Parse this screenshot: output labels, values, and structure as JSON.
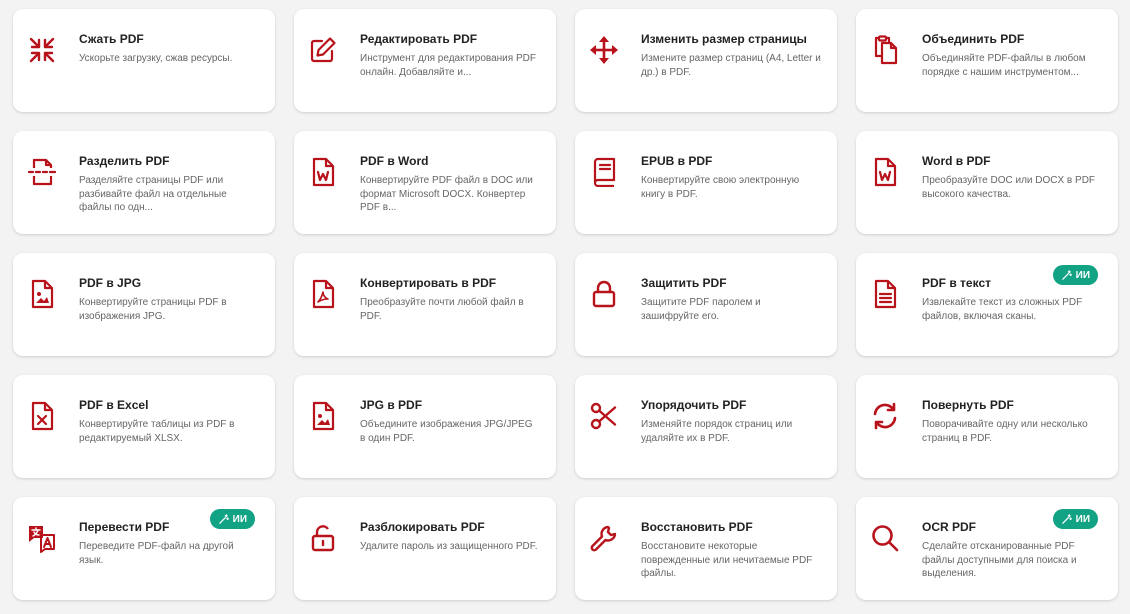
{
  "accent_color": "#b8121b",
  "badge_color": "#12a284",
  "tools": [
    {
      "icon": "compress-icon",
      "title": "Сжать PDF",
      "desc": "Ускорьте загрузку, сжав ресурсы."
    },
    {
      "icon": "edit-icon",
      "title": "Редактировать PDF",
      "desc": "Инструмент для редактирования PDF онлайн. Добавляйте и..."
    },
    {
      "icon": "move-arrows-icon",
      "title": "Изменить размер страницы",
      "desc": "Измените размер страниц (A4, Letter и др.) в PDF."
    },
    {
      "icon": "merge-files-icon",
      "title": "Объединить PDF",
      "desc": "Объединяйте PDF-файлы в любом порядке с нашим инструментом..."
    },
    {
      "icon": "split-icon",
      "title": "Разделить PDF",
      "desc": "Разделяйте страницы PDF или разбивайте файл на отдельные файлы по одн..."
    },
    {
      "icon": "word-file-icon",
      "title": "PDF в Word",
      "desc": "Конвертируйте PDF файл в DOC или формат Microsoft DOCX. Конвертер PDF в..."
    },
    {
      "icon": "book-icon",
      "title": "EPUB в PDF",
      "desc": "Конвертируйте свою электронную книгу в PDF."
    },
    {
      "icon": "word-file-icon",
      "title": "Word в PDF",
      "desc": "Преобразуйте DOC или DOCX в PDF высокого качества."
    },
    {
      "icon": "image-file-icon",
      "title": "PDF в JPG",
      "desc": "Конвертируйте страницы PDF в изображения JPG."
    },
    {
      "icon": "pdf-file-icon",
      "title": "Конвертировать в PDF",
      "desc": "Преобразуйте почти любой файл в PDF."
    },
    {
      "icon": "lock-icon",
      "title": "Защитить PDF",
      "desc": "Защитите PDF паролем и зашифруйте его."
    },
    {
      "icon": "text-file-icon",
      "title": "PDF в текст",
      "desc": "Извлекайте текст из сложных PDF файлов, включая сканы.",
      "badge": "ИИ"
    },
    {
      "icon": "excel-file-icon",
      "title": "PDF в Excel",
      "desc": "Конвертируйте таблицы из PDF в редактируемый XLSX."
    },
    {
      "icon": "image-file-icon",
      "title": "JPG в PDF",
      "desc": "Объедините изображения JPG/JPEG в один PDF."
    },
    {
      "icon": "scissors-icon",
      "title": "Упорядочить PDF",
      "desc": "Изменяйте порядок страниц или удаляйте их в PDF."
    },
    {
      "icon": "rotate-icon",
      "title": "Повернуть PDF",
      "desc": "Поворачивайте одну или несколько страниц в PDF."
    },
    {
      "icon": "translate-icon",
      "title": "Перевести PDF",
      "desc": "Переведите PDF-файл на другой язык.",
      "badge": "ИИ"
    },
    {
      "icon": "unlock-icon",
      "title": "Разблокировать PDF",
      "desc": "Удалите пароль из защищенного PDF."
    },
    {
      "icon": "wrench-icon",
      "title": "Восстановить PDF",
      "desc": "Восстановите некоторые поврежденные или нечитаемые PDF файлы."
    },
    {
      "icon": "search-icon",
      "title": "OCR PDF",
      "desc": "Сделайте отсканированные PDF файлы доступными для поиска и выделения.",
      "badge": "ИИ"
    }
  ]
}
